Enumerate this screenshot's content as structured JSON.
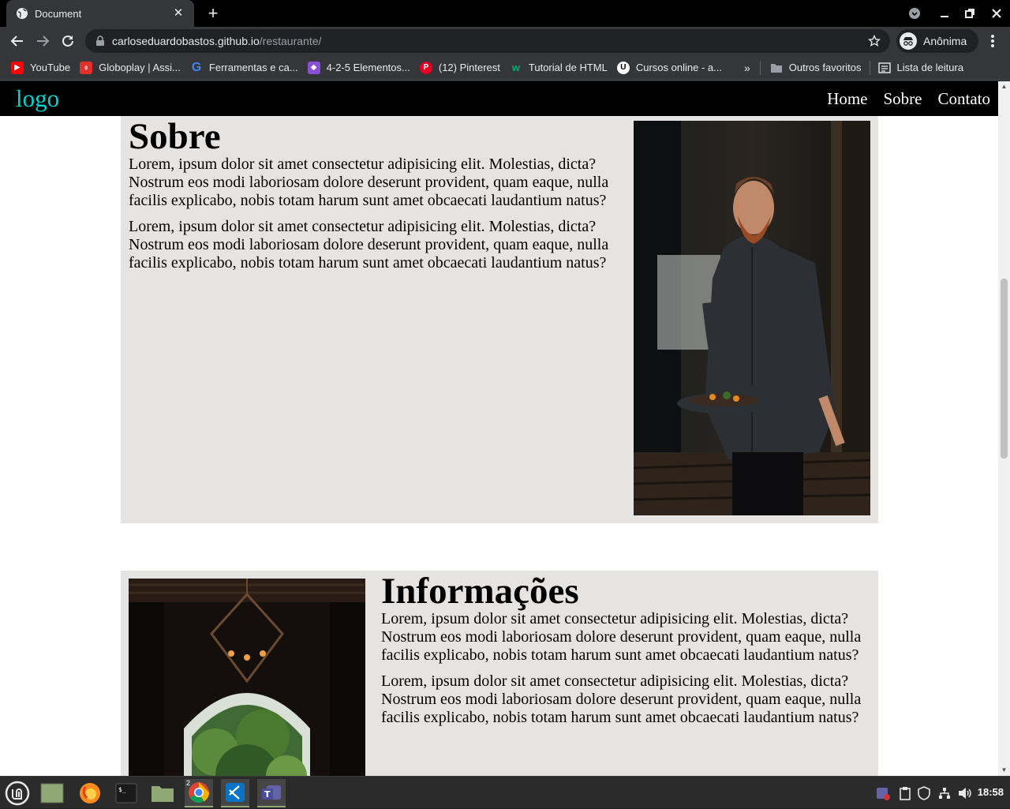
{
  "browser": {
    "tab_title": "Document",
    "url_host": "carloseduardobastos.github.io",
    "url_path": "/restaurante/",
    "profile_label": "Anônima"
  },
  "bookmarks": [
    {
      "label": "YouTube",
      "icon": "youtube-icon",
      "color": "#ff0000"
    },
    {
      "label": "Globoplay | Assi...",
      "icon": "globoplay-icon",
      "color": "#e4302b"
    },
    {
      "label": "Ferramentas e ca...",
      "icon": "google-icon",
      "color": "#4285f4"
    },
    {
      "label": "4-2-5 Elementos...",
      "icon": "twitch-icon",
      "color": "#8a4fd6"
    },
    {
      "label": "(12) Pinterest",
      "icon": "pinterest-icon",
      "color": "#e60023"
    },
    {
      "label": "Tutorial de HTML",
      "icon": "w3schools-icon",
      "color": "#04aa6d"
    },
    {
      "label": "Cursos online - a...",
      "icon": "udemy-icon",
      "color": "#ffffff"
    }
  ],
  "bookmarks_more": "»",
  "other_bookmarks": "Outros favoritos",
  "reading_list": "Lista de leitura",
  "site": {
    "logo": "logo",
    "nav": [
      "Home",
      "Sobre",
      "Contato"
    ],
    "sobre": {
      "title": "Sobre",
      "paragraphs": [
        "Lorem, ipsum dolor sit amet consectetur adipisicing elit. Molestias, dicta? Nostrum eos modi laboriosam dolore deserunt provident, quam eaque, nulla facilis explicabo, nobis totam harum sunt amet obcaecati laudantium natus?",
        "Lorem, ipsum dolor sit amet consectetur adipisicing elit. Molestias, dicta? Nostrum eos modi laboriosam dolore deserunt provident, quam eaque, nulla facilis explicabo, nobis totam harum sunt amet obcaecati laudantium natus?"
      ]
    },
    "informacoes": {
      "title": "Informações",
      "paragraphs": [
        "Lorem, ipsum dolor sit amet consectetur adipisicing elit. Molestias, dicta? Nostrum eos modi laboriosam dolore deserunt provident, quam eaque, nulla facilis explicabo, nobis totam harum sunt amet obcaecati laudantium natus?",
        "Lorem, ipsum dolor sit amet consectetur adipisicing elit. Molestias, dicta? Nostrum eos modi laboriosam dolore deserunt provident, quam eaque, nulla facilis explicabo, nobis totam harum sunt amet obcaecati laudantium natus?"
      ]
    }
  },
  "taskbar": {
    "apps": [
      "mint-menu-icon",
      "desktop-icon",
      "firefox-icon",
      "terminal-icon",
      "files-icon",
      "chrome-icon",
      "vscode-icon",
      "teams-icon"
    ],
    "chrome_window_count": "2",
    "clock": "18:58"
  },
  "colors": {
    "logo": "#00d2d2",
    "section_bg": "#e6e4e2",
    "site_nav_bg": "#000000"
  }
}
